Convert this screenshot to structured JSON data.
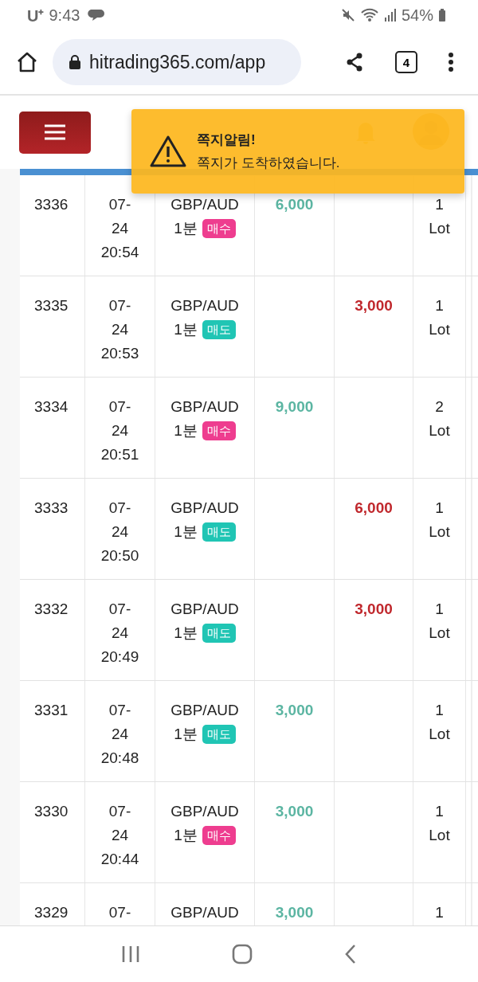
{
  "status_bar": {
    "carrier": "U⁺",
    "time": "9:43",
    "battery": "54%"
  },
  "browser": {
    "url": "hitrading365.com/app",
    "tab_count": "4"
  },
  "toast": {
    "title": "쪽지알림!",
    "message": "쪽지가 도착하였습니다."
  },
  "table": {
    "rows": [
      {
        "id": "3336",
        "date": [
          "07-",
          "24",
          "20:54"
        ],
        "pair": "GBP/AUD",
        "period": "1분",
        "side": {
          "label": "매수",
          "kind": "buy"
        },
        "profit": "6,000",
        "loss": "",
        "lots": [
          "1",
          "Lot"
        ]
      },
      {
        "id": "3335",
        "date": [
          "07-",
          "24",
          "20:53"
        ],
        "pair": "GBP/AUD",
        "period": "1분",
        "side": {
          "label": "매도",
          "kind": "sell"
        },
        "profit": "",
        "loss": "3,000",
        "lots": [
          "1",
          "Lot"
        ]
      },
      {
        "id": "3334",
        "date": [
          "07-",
          "24",
          "20:51"
        ],
        "pair": "GBP/AUD",
        "period": "1분",
        "side": {
          "label": "매수",
          "kind": "buy"
        },
        "profit": "9,000",
        "loss": "",
        "lots": [
          "2",
          "Lot"
        ]
      },
      {
        "id": "3333",
        "date": [
          "07-",
          "24",
          "20:50"
        ],
        "pair": "GBP/AUD",
        "period": "1분",
        "side": {
          "label": "매도",
          "kind": "sell"
        },
        "profit": "",
        "loss": "6,000",
        "lots": [
          "1",
          "Lot"
        ]
      },
      {
        "id": "3332",
        "date": [
          "07-",
          "24",
          "20:49"
        ],
        "pair": "GBP/AUD",
        "period": "1분",
        "side": {
          "label": "매도",
          "kind": "sell"
        },
        "profit": "",
        "loss": "3,000",
        "lots": [
          "1",
          "Lot"
        ]
      },
      {
        "id": "3331",
        "date": [
          "07-",
          "24",
          "20:48"
        ],
        "pair": "GBP/AUD",
        "period": "1분",
        "side": {
          "label": "매도",
          "kind": "sell"
        },
        "profit": "3,000",
        "loss": "",
        "lots": [
          "1",
          "Lot"
        ]
      },
      {
        "id": "3330",
        "date": [
          "07-",
          "24",
          "20:44"
        ],
        "pair": "GBP/AUD",
        "period": "1분",
        "side": {
          "label": "매수",
          "kind": "buy"
        },
        "profit": "3,000",
        "loss": "",
        "lots": [
          "1",
          "Lot"
        ]
      },
      {
        "id": "3329",
        "date": [
          "07-"
        ],
        "pair": "GBP/AUD",
        "profit": "3,000",
        "loss": "",
        "lots": [
          "1"
        ]
      }
    ]
  }
}
